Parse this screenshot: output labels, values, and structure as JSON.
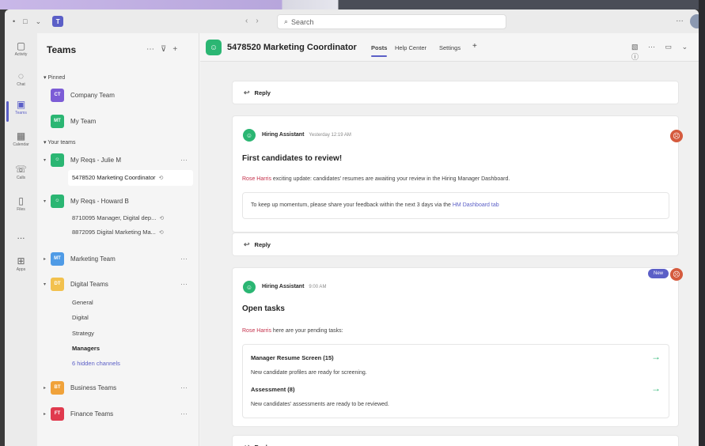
{
  "search": {
    "placeholder": "Search"
  },
  "rail": [
    {
      "icon": "bell-icon",
      "label": "Activity"
    },
    {
      "icon": "chat-icon",
      "label": "Chat"
    },
    {
      "icon": "teams-icon",
      "label": "Teams"
    },
    {
      "icon": "calendar-icon",
      "label": "Calendar"
    },
    {
      "icon": "phone-icon",
      "label": "Calls"
    },
    {
      "icon": "file-icon",
      "label": "Files"
    },
    {
      "icon": "more-icon",
      "label": "..."
    },
    {
      "icon": "apps-icon",
      "label": "Apps"
    }
  ],
  "sidebar": {
    "title": "Teams",
    "pinned_label": "Pinned",
    "your_teams_label": "Your teams",
    "pinned": [
      {
        "initials": "CT",
        "name": "Company Team",
        "color": "#7c5cd6"
      },
      {
        "initials": "MT",
        "name": "My Team",
        "color": "#2bb673"
      }
    ],
    "teams": [
      {
        "initials": "",
        "name": "My Reqs - Julie M",
        "color": "#2bb673"
      },
      {
        "initials": "",
        "name": "My Reqs - Howard B",
        "color": "#2bb673"
      },
      {
        "initials": "MT",
        "name": "Marketing Team",
        "color": "#4f9be6"
      },
      {
        "initials": "DT",
        "name": "Digital Teams",
        "color": "#f2c14e"
      },
      {
        "initials": "BT",
        "name": "Business Teams",
        "color": "#f0a23a"
      },
      {
        "initials": "FT",
        "name": "Finance Teams",
        "color": "#e03a4e"
      }
    ],
    "channels_julie": [
      "5478520 Marketing Coordinator"
    ],
    "channels_howard": [
      "8710095 Manager, Digital dep...",
      "8872095 Digital Marketing Ma..."
    ],
    "channels_digital": [
      "General",
      "Digital",
      "Strategy",
      "Managers"
    ],
    "hidden_channels": "6 hidden channels"
  },
  "channel": {
    "title": "5478520 Marketing Coordinator",
    "tabs": [
      "Posts",
      "Help Center",
      "Settings"
    ],
    "add_tab": "+"
  },
  "posts": {
    "reply_label": "Reply",
    "p1": {
      "author": "Hiring Assistant",
      "time": "Yesterday 12:19 AM",
      "title": "First candidates to review!",
      "mention": "Rose Harris",
      "text": " exciting update: candidates' resumes are awaiting your review in the Hiring Manager Dashboard.",
      "inner_text": "To keep up momentum, please share your feedback within the next 3 days via the ",
      "inner_link": "HM Dashboard tab"
    },
    "p2": {
      "author": "Hiring Assistant",
      "time": "9:00 AM",
      "badge": "New",
      "title": "Open tasks",
      "mention": "Rose Harris",
      "text": " here are your pending tasks:",
      "tasks": [
        {
          "title": "Manager Resume Screen (15)",
          "desc": "New candidate profiles are ready for screening."
        },
        {
          "title": "Assessment (8)",
          "desc": "New candidates' assessments are ready to be reviewed."
        }
      ]
    }
  },
  "colors": {
    "accent": "#5b5fc7",
    "bot": "#2bb673",
    "mention": "#c4314b"
  }
}
